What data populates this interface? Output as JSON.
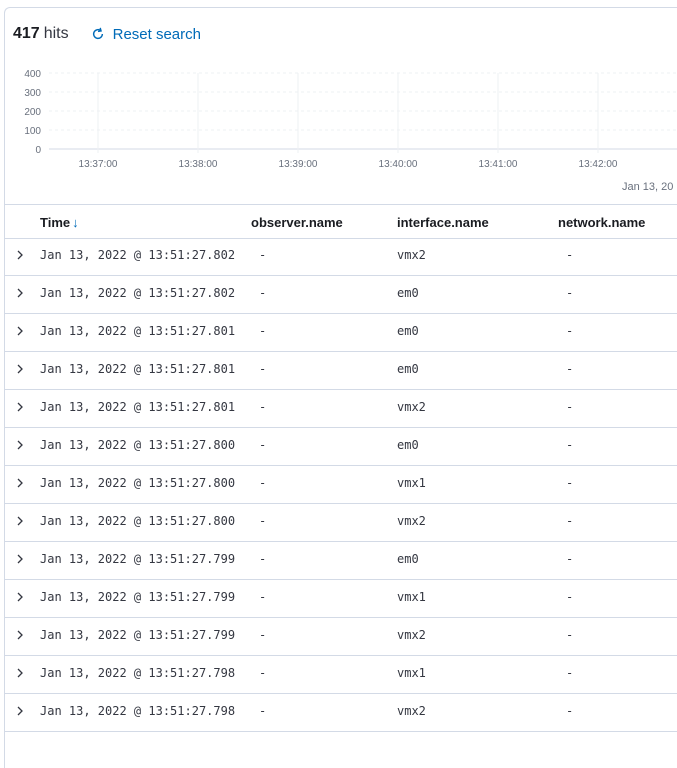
{
  "hits": {
    "count": "417",
    "label": "hits"
  },
  "reset": {
    "label": "Reset search",
    "icon": "refresh-icon"
  },
  "histogram": {
    "y_ticks": [
      "400",
      "300",
      "200",
      "100",
      "0"
    ],
    "x_ticks": [
      "13:37:00",
      "13:38:00",
      "13:39:00",
      "13:40:00",
      "13:41:00",
      "13:42:00"
    ],
    "date_label": "Jan 13, 20"
  },
  "table": {
    "columns": {
      "time": "Time",
      "observer": "observer.name",
      "interface": "interface.name",
      "network": "network.name"
    },
    "rows": [
      {
        "time": "Jan 13, 2022 @ 13:51:27.802",
        "observer": "-",
        "interface": "vmx2",
        "network": "-"
      },
      {
        "time": "Jan 13, 2022 @ 13:51:27.802",
        "observer": "-",
        "interface": "em0",
        "network": "-"
      },
      {
        "time": "Jan 13, 2022 @ 13:51:27.801",
        "observer": "-",
        "interface": "em0",
        "network": "-"
      },
      {
        "time": "Jan 13, 2022 @ 13:51:27.801",
        "observer": "-",
        "interface": "em0",
        "network": "-"
      },
      {
        "time": "Jan 13, 2022 @ 13:51:27.801",
        "observer": "-",
        "interface": "vmx2",
        "network": "-"
      },
      {
        "time": "Jan 13, 2022 @ 13:51:27.800",
        "observer": "-",
        "interface": "em0",
        "network": "-"
      },
      {
        "time": "Jan 13, 2022 @ 13:51:27.800",
        "observer": "-",
        "interface": "vmx1",
        "network": "-"
      },
      {
        "time": "Jan 13, 2022 @ 13:51:27.800",
        "observer": "-",
        "interface": "vmx2",
        "network": "-"
      },
      {
        "time": "Jan 13, 2022 @ 13:51:27.799",
        "observer": "-",
        "interface": "em0",
        "network": "-"
      },
      {
        "time": "Jan 13, 2022 @ 13:51:27.799",
        "observer": "-",
        "interface": "vmx1",
        "network": "-"
      },
      {
        "time": "Jan 13, 2022 @ 13:51:27.799",
        "observer": "-",
        "interface": "vmx2",
        "network": "-"
      },
      {
        "time": "Jan 13, 2022 @ 13:51:27.798",
        "observer": "-",
        "interface": "vmx1",
        "network": "-"
      },
      {
        "time": "Jan 13, 2022 @ 13:51:27.798",
        "observer": "-",
        "interface": "vmx2",
        "network": "-"
      }
    ]
  },
  "colors": {
    "accent": "#006bb8",
    "border": "#d3dae6",
    "text": "#343741"
  }
}
